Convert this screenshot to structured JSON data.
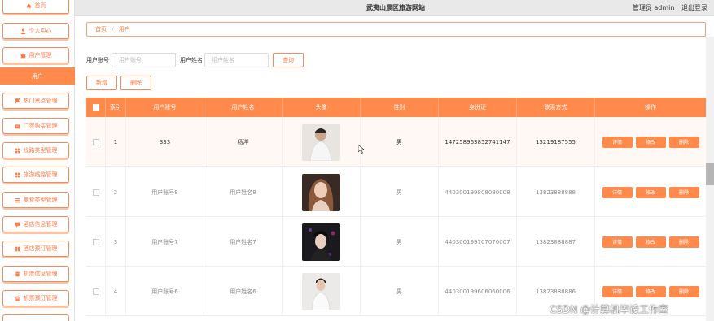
{
  "app": {
    "title": "武夷山景区旅游网站",
    "user_role": "管理员 admin",
    "logout": "退出登录"
  },
  "sidebar": {
    "items": [
      {
        "label": "首页",
        "icon": "home-icon"
      },
      {
        "label": "个人中心",
        "icon": "person-icon"
      },
      {
        "label": "用户管理",
        "icon": "users-icon"
      },
      {
        "label": "用户",
        "icon": ""
      },
      {
        "label": "热门景点管理",
        "icon": "flag-icon"
      },
      {
        "label": "门票购买管理",
        "icon": "ticket-icon"
      },
      {
        "label": "线路类型管理",
        "icon": "grid-icon"
      },
      {
        "label": "旅游线路管理",
        "icon": "grid-icon"
      },
      {
        "label": "美食类型管理",
        "icon": "list-icon"
      },
      {
        "label": "酒店信息管理",
        "icon": "chat-icon"
      },
      {
        "label": "酒店预订管理",
        "icon": "grid-icon"
      },
      {
        "label": "机票信息管理",
        "icon": "building-icon"
      },
      {
        "label": "机票预订管理",
        "icon": "doc-icon"
      }
    ]
  },
  "breadcrumb": {
    "home": "首页",
    "separator": "/",
    "current": "用户"
  },
  "search": {
    "account_label": "用户账号",
    "account_placeholder": "用户账号",
    "name_label": "用户姓名",
    "name_placeholder": "用户姓名",
    "query_button": "查询"
  },
  "actions": {
    "add": "新增",
    "delete": "删除"
  },
  "table": {
    "headers": [
      "",
      "索引",
      "用户账号",
      "用户姓名",
      "头像",
      "性别",
      "身份证",
      "联系方式",
      "操作"
    ],
    "rows": [
      {
        "index": "1",
        "account": "333",
        "name": "杨洋",
        "gender": "男",
        "id_card": "147258963852741147",
        "phone": "15219187555"
      },
      {
        "index": "2",
        "account": "用户账号8",
        "name": "用户姓名8",
        "gender": "男",
        "id_card": "440300199808080008",
        "phone": "13823888888"
      },
      {
        "index": "3",
        "account": "用户账号7",
        "name": "用户姓名7",
        "gender": "男",
        "id_card": "440300199707070007",
        "phone": "13823888887"
      },
      {
        "index": "4",
        "account": "用户账号6",
        "name": "用户姓名6",
        "gender": "男",
        "id_card": "440300199606060006",
        "phone": "13823888886"
      }
    ],
    "row_actions": {
      "detail": "详情",
      "edit": "修改",
      "delete": "删除"
    }
  },
  "watermark": "CSDN @计算机毕设工作室",
  "colors": {
    "accent": "#ff8a4c",
    "accent_text": "#ff7a45"
  }
}
